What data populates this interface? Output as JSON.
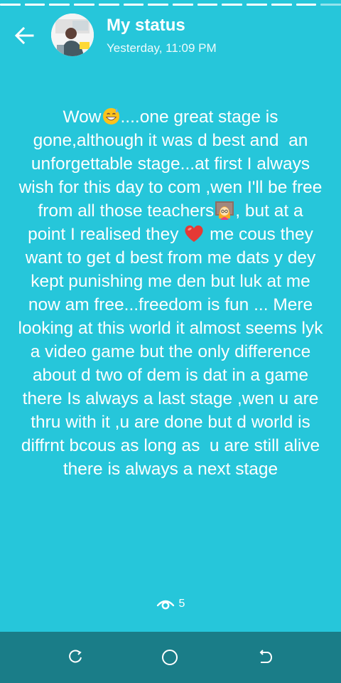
{
  "status": {
    "title": "My status",
    "timestamp": "Yesterday, 11:09 PM",
    "segments": 14,
    "viewed_segments": 13,
    "text_segments": [
      "Wow",
      "....one great stage is gone,although it was d best and  an unforgettable stage...at first I always wish for this day to com ,wen I'll be free from all those teachers",
      ", but at a point I realised they ",
      " me cous they want to get d best from me dats y dey kept punishing me den but luk at me now am free...freedom is fun ... Mere looking at this world it almost seems lyk a video game but the only difference about d two of dem is dat in a game there Is always a last stage ,wen u are thru with it ,u are done but d world is diffrnt bcous as long as  u are still alive there is always a next stage"
    ],
    "emojis": [
      "grinning-sweat-emoji",
      "teacher-emoji",
      "red-heart-emoji"
    ],
    "view_count": "5"
  },
  "colors": {
    "background": "#26c6da",
    "nav_bar": "#1a7d88",
    "text": "#ffffff",
    "heart": "#e53935"
  },
  "icons": {
    "back": "arrow-left-icon",
    "views": "eye-icon",
    "nav_recents": "recents-icon",
    "nav_home": "home-circle-icon",
    "nav_back": "back-icon"
  }
}
